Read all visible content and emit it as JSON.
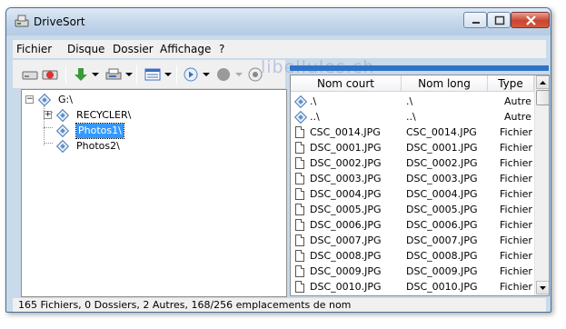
{
  "window": {
    "title": "DriveSort",
    "watermark": "libellules.ch"
  },
  "menu": [
    "Fichier",
    "Disque",
    "Dossier",
    "Affichage",
    "?"
  ],
  "toolbar": {
    "buttons": [
      "disk-icon",
      "eject-red-icon",
      "download-arrow-icon",
      "printer-icon",
      "list-view-icon",
      "play-icon",
      "record-icon",
      "stop-icon"
    ]
  },
  "tree": [
    {
      "label": "G:\\",
      "icon": "drive-icon",
      "expand": "−"
    },
    {
      "label": "RECYCLER\\",
      "icon": "folder-icon",
      "expand": "+"
    },
    {
      "label": "Photos1\\",
      "icon": "folder-icon",
      "selected": true
    },
    {
      "label": "Photos2\\",
      "icon": "folder-icon"
    }
  ],
  "list": {
    "columns": [
      "Nom court",
      "Nom long",
      "Type"
    ],
    "rows": [
      {
        "short": ".\\",
        "long": ".\\",
        "type": "Autre",
        "icon": "folder-icon"
      },
      {
        "short": "..\\",
        "long": "..\\",
        "type": "Autre",
        "icon": "folder-icon"
      },
      {
        "short": "CSC_0014.JPG",
        "long": "CSC_0014.JPG",
        "type": "Fichier",
        "icon": "file-icon"
      },
      {
        "short": "DSC_0001.JPG",
        "long": "DSC_0001.JPG",
        "type": "Fichier",
        "icon": "file-icon"
      },
      {
        "short": "DSC_0002.JPG",
        "long": "DSC_0002.JPG",
        "type": "Fichier",
        "icon": "file-icon"
      },
      {
        "short": "DSC_0003.JPG",
        "long": "DSC_0003.JPG",
        "type": "Fichier",
        "icon": "file-icon"
      },
      {
        "short": "DSC_0004.JPG",
        "long": "DSC_0004.JPG",
        "type": "Fichier",
        "icon": "file-icon"
      },
      {
        "short": "DSC_0005.JPG",
        "long": "DSC_0005.JPG",
        "type": "Fichier",
        "icon": "file-icon"
      },
      {
        "short": "DSC_0006.JPG",
        "long": "DSC_0006.JPG",
        "type": "Fichier",
        "icon": "file-icon"
      },
      {
        "short": "DSC_0007.JPG",
        "long": "DSC_0007.JPG",
        "type": "Fichier",
        "icon": "file-icon"
      },
      {
        "short": "DSC_0008.JPG",
        "long": "DSC_0008.JPG",
        "type": "Fichier",
        "icon": "file-icon"
      },
      {
        "short": "DSC_0009.JPG",
        "long": "DSC_0009.JPG",
        "type": "Fichier",
        "icon": "file-icon"
      },
      {
        "short": "DSC_0010.JPG",
        "long": "DSC_0010.JPG",
        "type": "Fichier",
        "icon": "file-icon"
      }
    ]
  },
  "status": "165 Fichiers, 0 Dossiers, 2 Autres, 168/256 emplacements de nom",
  "colors": {
    "titlebar": "#c3d6ea",
    "selection": "#3399ff",
    "progress": "#2f73c8",
    "close": "#c9452f"
  }
}
